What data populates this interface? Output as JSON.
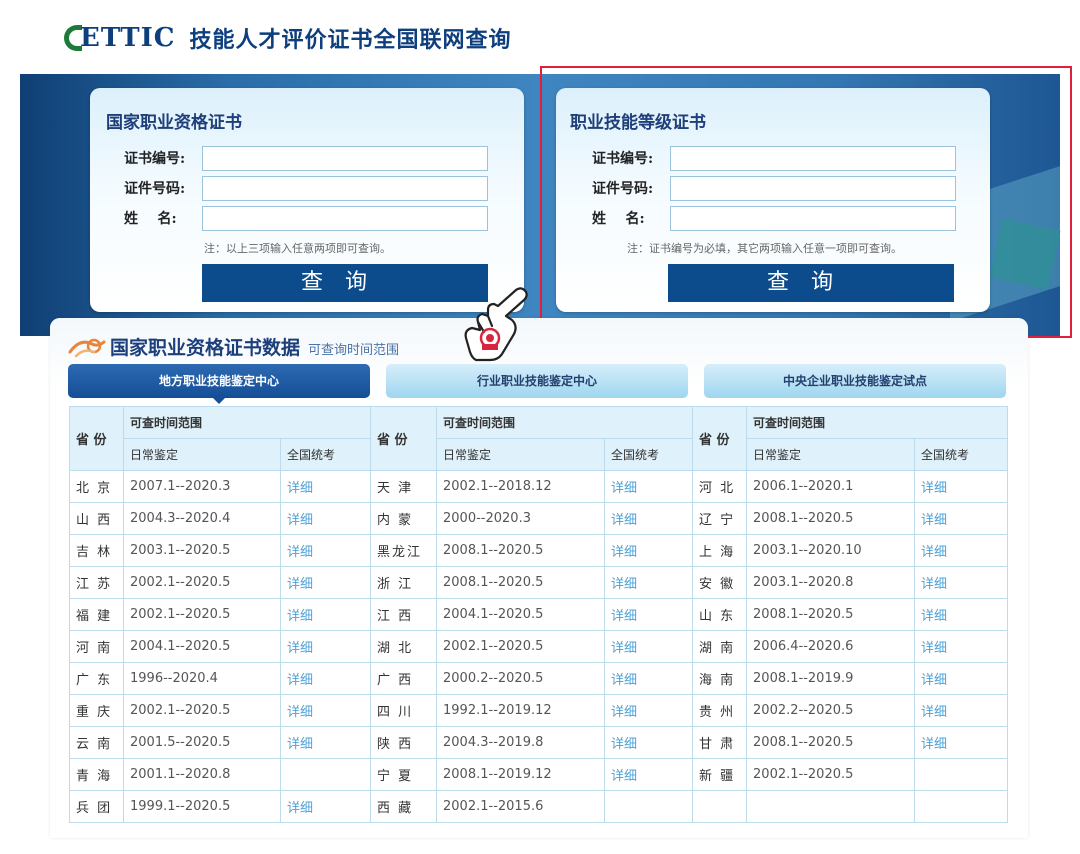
{
  "header": {
    "logo_text": "ETTIC",
    "title": "技能人才评价证书全国联网查询"
  },
  "left_card": {
    "title": "国家职业资格证书",
    "fields": [
      {
        "label": "证书编号:",
        "value": ""
      },
      {
        "label": "证件号码:",
        "value": ""
      },
      {
        "label": "姓    名:",
        "value": ""
      }
    ],
    "note": "注：以上三项输入任意两项即可查询。",
    "button": "查询"
  },
  "right_card": {
    "title": "职业技能等级证书",
    "fields": [
      {
        "label": "证书编号:",
        "value": ""
      },
      {
        "label": "证件号码:",
        "value": ""
      },
      {
        "label": "姓    名:",
        "value": ""
      }
    ],
    "note": "注：证书编号为必填，其它两项输入任意一项即可查询。",
    "button": "查询"
  },
  "panel": {
    "title": "国家职业资格证书数据",
    "subtitle": "可查询时间范围",
    "tabs": [
      "地方职业技能鉴定中心",
      "行业职业技能鉴定中心",
      "中央企业职业技能鉴定试点"
    ]
  },
  "table": {
    "headers": {
      "province": "省 份",
      "range": "可查时间范围",
      "daily": "日常鉴定",
      "national": "全国统考"
    },
    "rows": [
      [
        [
          "北 京",
          "2007.1--2020.3",
          "详细"
        ],
        [
          "天 津",
          "2002.1--2018.12",
          "详细"
        ],
        [
          "河 北",
          "2006.1--2020.1",
          "详细"
        ]
      ],
      [
        [
          "山 西",
          "2004.3--2020.4",
          "详细"
        ],
        [
          "内 蒙",
          "2000--2020.3",
          "详细"
        ],
        [
          "辽 宁",
          "2008.1--2020.5",
          "详细"
        ]
      ],
      [
        [
          "吉 林",
          "2003.1--2020.5",
          "详细"
        ],
        [
          "黑龙江",
          "2008.1--2020.5",
          "详细"
        ],
        [
          "上 海",
          "2003.1--2020.10",
          "详细"
        ]
      ],
      [
        [
          "江 苏",
          "2002.1--2020.5",
          "详细"
        ],
        [
          "浙 江",
          "2008.1--2020.5",
          "详细"
        ],
        [
          "安 徽",
          "2003.1--2020.8",
          "详细"
        ]
      ],
      [
        [
          "福 建",
          "2002.1--2020.5",
          "详细"
        ],
        [
          "江 西",
          "2004.1--2020.5",
          "详细"
        ],
        [
          "山 东",
          "2008.1--2020.5",
          "详细"
        ]
      ],
      [
        [
          "河 南",
          "2004.1--2020.5",
          "详细"
        ],
        [
          "湖 北",
          "2002.1--2020.5",
          "详细"
        ],
        [
          "湖 南",
          "2006.4--2020.6",
          "详细"
        ]
      ],
      [
        [
          "广 东",
          "1996--2020.4",
          "详细"
        ],
        [
          "广 西",
          "2000.2--2020.5",
          "详细"
        ],
        [
          "海 南",
          "2008.1--2019.9",
          "详细"
        ]
      ],
      [
        [
          "重 庆",
          "2002.1--2020.5",
          "详细"
        ],
        [
          "四 川",
          "1992.1--2019.12",
          "详细"
        ],
        [
          "贵 州",
          "2002.2--2020.5",
          "详细"
        ]
      ],
      [
        [
          "云 南",
          "2001.5--2020.5",
          "详细"
        ],
        [
          "陕 西",
          "2004.3--2019.8",
          "详细"
        ],
        [
          "甘 肃",
          "2008.1--2020.5",
          "详细"
        ]
      ],
      [
        [
          "青 海",
          "2001.1--2020.8",
          ""
        ],
        [
          "宁 夏",
          "2008.1--2019.12",
          "详细"
        ],
        [
          "新 疆",
          "2002.1--2020.5",
          ""
        ]
      ],
      [
        [
          "兵 团",
          "1999.1--2020.5",
          "详细"
        ],
        [
          "西 藏",
          "2002.1--2015.6",
          ""
        ],
        [
          "",
          "",
          ""
        ]
      ]
    ]
  },
  "colors": {
    "brand_blue": "#0c4c8c",
    "title_blue": "#1e3f7a",
    "link_blue": "#4aa3d8",
    "highlight_red": "#e0203a",
    "logo_green": "#1c7a3a"
  }
}
